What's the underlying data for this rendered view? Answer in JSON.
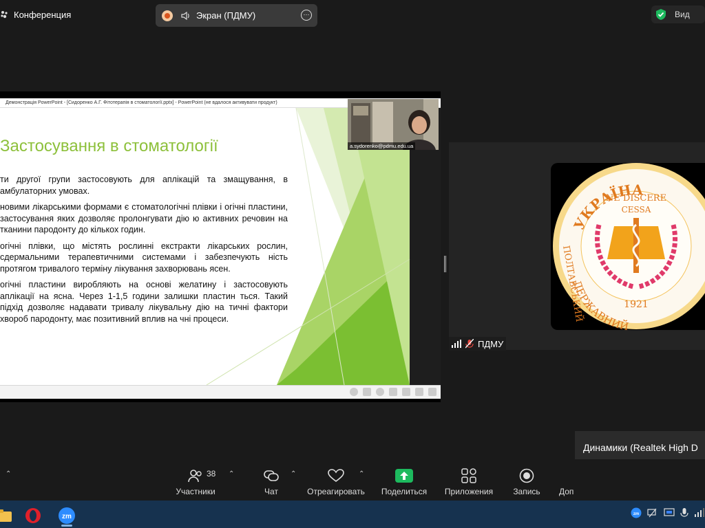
{
  "topbar": {
    "conference_label": "Конференция",
    "share_label": "Экран (ПДМУ)",
    "view_label": "Вид"
  },
  "slide": {
    "window_title": "Демонстрація PowerPoint - [Сидоренко А.Г. Фітотерапія в стоматології.pptx] - PowerPoint (не вдалося активувати продукт)",
    "heading": "Застосування в стоматології",
    "paragraphs": [
      "ти другої групи застосовують для аплікацій та змащування, в амбулаторних умовах.",
      "новими лікарськими формами є стоматологічні плівки і огічні пластини, застосування яких дозволяє пролонгувати дію ю активних речовин на тканини пародонту до кількох годин.",
      "огічні плівки, що містять рослинні екстракти лікарських рослин, сдермальними терапевтичними системами і забезпечують ність протягом тривалого терміну лікування захворювань ясен.",
      "огічні пластини виробляють на основі желатину і застосовують аплікації на ясна. Через 1-1,5 години залишки пластин ться. Такий підхід дозволяє надавати тривалу лікувальну дію на тичні фактори хвороб пародонту, має позитивний вплив на чні процеси."
    ]
  },
  "presenter": {
    "email": "a.sydorenko@pdmu.edu.ua"
  },
  "participant_tile": {
    "name": "ПДМУ",
    "logo_text_top": "УКРАЇНА",
    "logo_motto_1": "NE DISCERE",
    "logo_motto_2": "CESSA",
    "logo_year": "1921",
    "logo_left": "ПОЛТАВСЬКИЙ",
    "logo_bottom": "ДЕРЖАВНИЙ",
    "logo_right": "МЕДИЧНИЙ"
  },
  "audio": {
    "device_label": "Динамики (Realtek High D",
    "volume_fraction": 0.43
  },
  "toolbar": {
    "participants_label": "Участники",
    "participants_count": "38",
    "chat_label": "Чат",
    "react_label": "Отреагировать",
    "share_label": "Поделиться",
    "apps_label": "Приложения",
    "record_label": "Запись",
    "more_label": "Доп"
  },
  "colors": {
    "accent_green": "#8dc03b",
    "share_green": "#1dba5e",
    "zoom_blue": "#2d8cff",
    "taskbar": "#16324f"
  }
}
